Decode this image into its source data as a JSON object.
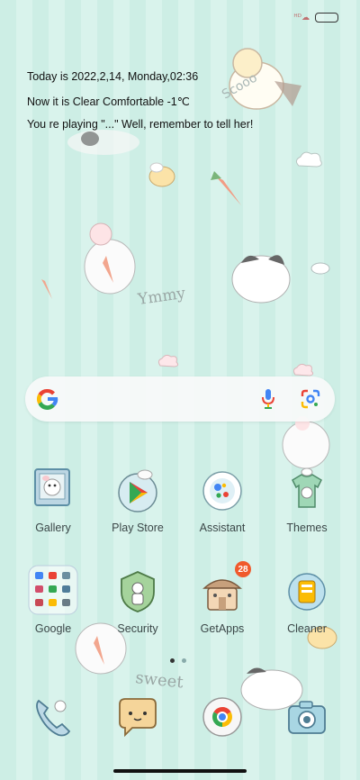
{
  "status_bar": {
    "status_icons": "ᴴᴰ☁",
    "battery_icon": "battery-icon"
  },
  "widget": {
    "date_line": "Today is 2022,2,14, Monday,02:36",
    "weather_line": "Now it is Clear  Comfortable -1℃",
    "message_line": "You re playing \"...\" Well, remember to tell her!"
  },
  "search_bar": {
    "logo_icon": "google-g-icon",
    "mic_icon": "microphone-icon",
    "lens_icon": "google-lens-icon"
  },
  "apps": {
    "row1": [
      {
        "label": "Gallery",
        "icon": "gallery-icon"
      },
      {
        "label": "Play Store",
        "icon": "play-store-icon"
      },
      {
        "label": "Assistant",
        "icon": "assistant-icon"
      },
      {
        "label": "Themes",
        "icon": "themes-icon"
      }
    ],
    "row2": [
      {
        "label": "Google",
        "icon": "google-folder-icon"
      },
      {
        "label": "Security",
        "icon": "security-icon"
      },
      {
        "label": "GetApps",
        "icon": "getapps-icon",
        "badge": "28"
      },
      {
        "label": "Cleaner",
        "icon": "cleaner-icon"
      }
    ]
  },
  "page_indicator": {
    "pages": 2,
    "current": 1
  },
  "colors": {
    "background": "#cfeee6",
    "badge": "#f05a2c",
    "label": "#3b4748",
    "google_blue": "#4285f4",
    "google_red": "#ea4335",
    "google_yellow": "#fbbc05",
    "google_green": "#34a853"
  }
}
